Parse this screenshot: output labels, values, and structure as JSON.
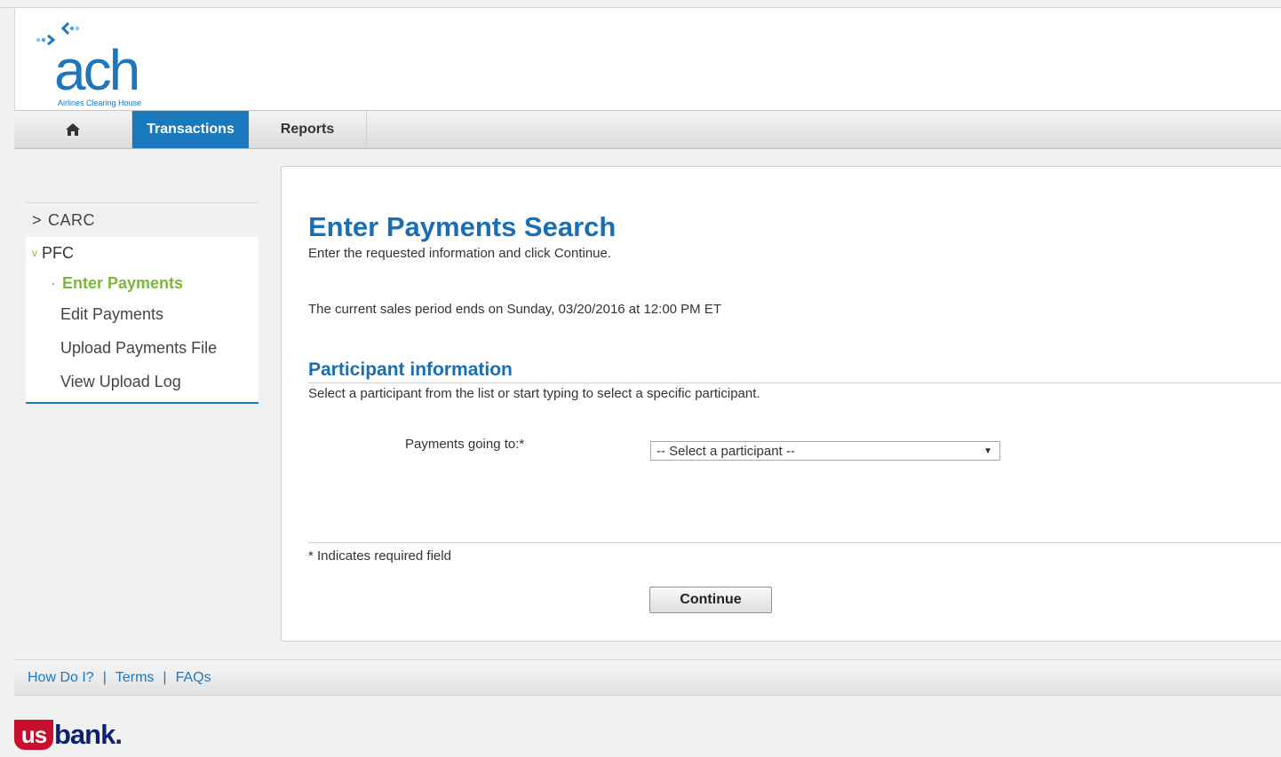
{
  "brand": {
    "logo_word": "ach",
    "logo_tagline": "Airlines Clearing House"
  },
  "nav": {
    "tabs": [
      {
        "label": "Transactions",
        "active": true
      },
      {
        "label": "Reports",
        "active": false
      }
    ]
  },
  "sidebar": {
    "carc": {
      "prefix": ">",
      "label": "CARC"
    },
    "pfc": {
      "prefix": "v",
      "label": "PFC"
    },
    "items": [
      {
        "prefix": "·",
        "label": "Enter Payments",
        "active": true
      },
      {
        "label": "Edit Payments"
      },
      {
        "label": "Upload Payments File"
      },
      {
        "label": "View Upload Log"
      }
    ]
  },
  "main": {
    "title": "Enter Payments Search",
    "subtitle": "Enter the requested information and click Continue.",
    "period_text": "The current sales period ends on Sunday, 03/20/2016 at 12:00 PM ET",
    "section": {
      "title": "Participant information",
      "description": "Select a participant from the list or start typing to select a specific participant."
    },
    "field": {
      "label": "Payments going to:*",
      "selected": "-- Select a participant --"
    },
    "required_note": "* Indicates required field",
    "continue_label": "Continue"
  },
  "footer": {
    "links": [
      "How Do I?",
      "Terms",
      "FAQs"
    ],
    "separator": "|"
  },
  "bank_logo": {
    "shield": "us",
    "word": "bank",
    "period": "."
  },
  "colors": {
    "accent_blue": "#1a78bd",
    "title_blue": "#1a6eb3",
    "active_green": "#7ab83b",
    "bank_red": "#c8102e",
    "bank_navy": "#0c2074"
  },
  "icons": {
    "home": "home-icon",
    "dropdown": "caret-down-icon"
  }
}
